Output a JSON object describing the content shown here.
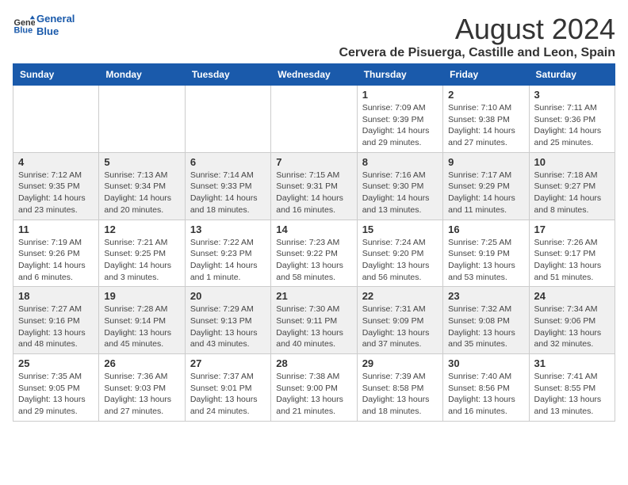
{
  "header": {
    "logo_line1": "General",
    "logo_line2": "Blue",
    "main_title": "August 2024",
    "subtitle": "Cervera de Pisuerga, Castille and Leon, Spain"
  },
  "weekdays": [
    "Sunday",
    "Monday",
    "Tuesday",
    "Wednesday",
    "Thursday",
    "Friday",
    "Saturday"
  ],
  "weeks": [
    [
      {
        "day": "",
        "info": ""
      },
      {
        "day": "",
        "info": ""
      },
      {
        "day": "",
        "info": ""
      },
      {
        "day": "",
        "info": ""
      },
      {
        "day": "1",
        "info": "Sunrise: 7:09 AM\nSunset: 9:39 PM\nDaylight: 14 hours\nand 29 minutes."
      },
      {
        "day": "2",
        "info": "Sunrise: 7:10 AM\nSunset: 9:38 PM\nDaylight: 14 hours\nand 27 minutes."
      },
      {
        "day": "3",
        "info": "Sunrise: 7:11 AM\nSunset: 9:36 PM\nDaylight: 14 hours\nand 25 minutes."
      }
    ],
    [
      {
        "day": "4",
        "info": "Sunrise: 7:12 AM\nSunset: 9:35 PM\nDaylight: 14 hours\nand 23 minutes."
      },
      {
        "day": "5",
        "info": "Sunrise: 7:13 AM\nSunset: 9:34 PM\nDaylight: 14 hours\nand 20 minutes."
      },
      {
        "day": "6",
        "info": "Sunrise: 7:14 AM\nSunset: 9:33 PM\nDaylight: 14 hours\nand 18 minutes."
      },
      {
        "day": "7",
        "info": "Sunrise: 7:15 AM\nSunset: 9:31 PM\nDaylight: 14 hours\nand 16 minutes."
      },
      {
        "day": "8",
        "info": "Sunrise: 7:16 AM\nSunset: 9:30 PM\nDaylight: 14 hours\nand 13 minutes."
      },
      {
        "day": "9",
        "info": "Sunrise: 7:17 AM\nSunset: 9:29 PM\nDaylight: 14 hours\nand 11 minutes."
      },
      {
        "day": "10",
        "info": "Sunrise: 7:18 AM\nSunset: 9:27 PM\nDaylight: 14 hours\nand 8 minutes."
      }
    ],
    [
      {
        "day": "11",
        "info": "Sunrise: 7:19 AM\nSunset: 9:26 PM\nDaylight: 14 hours\nand 6 minutes."
      },
      {
        "day": "12",
        "info": "Sunrise: 7:21 AM\nSunset: 9:25 PM\nDaylight: 14 hours\nand 3 minutes."
      },
      {
        "day": "13",
        "info": "Sunrise: 7:22 AM\nSunset: 9:23 PM\nDaylight: 14 hours\nand 1 minute."
      },
      {
        "day": "14",
        "info": "Sunrise: 7:23 AM\nSunset: 9:22 PM\nDaylight: 13 hours\nand 58 minutes."
      },
      {
        "day": "15",
        "info": "Sunrise: 7:24 AM\nSunset: 9:20 PM\nDaylight: 13 hours\nand 56 minutes."
      },
      {
        "day": "16",
        "info": "Sunrise: 7:25 AM\nSunset: 9:19 PM\nDaylight: 13 hours\nand 53 minutes."
      },
      {
        "day": "17",
        "info": "Sunrise: 7:26 AM\nSunset: 9:17 PM\nDaylight: 13 hours\nand 51 minutes."
      }
    ],
    [
      {
        "day": "18",
        "info": "Sunrise: 7:27 AM\nSunset: 9:16 PM\nDaylight: 13 hours\nand 48 minutes."
      },
      {
        "day": "19",
        "info": "Sunrise: 7:28 AM\nSunset: 9:14 PM\nDaylight: 13 hours\nand 45 minutes."
      },
      {
        "day": "20",
        "info": "Sunrise: 7:29 AM\nSunset: 9:13 PM\nDaylight: 13 hours\nand 43 minutes."
      },
      {
        "day": "21",
        "info": "Sunrise: 7:30 AM\nSunset: 9:11 PM\nDaylight: 13 hours\nand 40 minutes."
      },
      {
        "day": "22",
        "info": "Sunrise: 7:31 AM\nSunset: 9:09 PM\nDaylight: 13 hours\nand 37 minutes."
      },
      {
        "day": "23",
        "info": "Sunrise: 7:32 AM\nSunset: 9:08 PM\nDaylight: 13 hours\nand 35 minutes."
      },
      {
        "day": "24",
        "info": "Sunrise: 7:34 AM\nSunset: 9:06 PM\nDaylight: 13 hours\nand 32 minutes."
      }
    ],
    [
      {
        "day": "25",
        "info": "Sunrise: 7:35 AM\nSunset: 9:05 PM\nDaylight: 13 hours\nand 29 minutes."
      },
      {
        "day": "26",
        "info": "Sunrise: 7:36 AM\nSunset: 9:03 PM\nDaylight: 13 hours\nand 27 minutes."
      },
      {
        "day": "27",
        "info": "Sunrise: 7:37 AM\nSunset: 9:01 PM\nDaylight: 13 hours\nand 24 minutes."
      },
      {
        "day": "28",
        "info": "Sunrise: 7:38 AM\nSunset: 9:00 PM\nDaylight: 13 hours\nand 21 minutes."
      },
      {
        "day": "29",
        "info": "Sunrise: 7:39 AM\nSunset: 8:58 PM\nDaylight: 13 hours\nand 18 minutes."
      },
      {
        "day": "30",
        "info": "Sunrise: 7:40 AM\nSunset: 8:56 PM\nDaylight: 13 hours\nand 16 minutes."
      },
      {
        "day": "31",
        "info": "Sunrise: 7:41 AM\nSunset: 8:55 PM\nDaylight: 13 hours\nand 13 minutes."
      }
    ]
  ]
}
